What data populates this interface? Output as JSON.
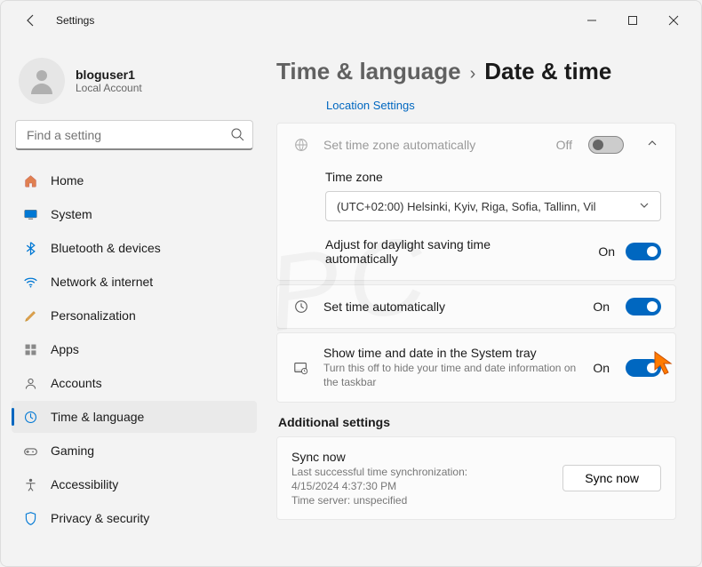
{
  "window": {
    "title": "Settings"
  },
  "user": {
    "name": "bloguser1",
    "subtitle": "Local Account"
  },
  "search": {
    "placeholder": "Find a setting"
  },
  "nav": {
    "home": "Home",
    "system": "System",
    "bluetooth": "Bluetooth & devices",
    "network": "Network & internet",
    "personalization": "Personalization",
    "apps": "Apps",
    "accounts": "Accounts",
    "time": "Time & language",
    "gaming": "Gaming",
    "accessibility": "Accessibility",
    "privacy": "Privacy & security"
  },
  "breadcrumb": {
    "parent": "Time & language",
    "sep": "›",
    "current": "Date & time"
  },
  "location_link": "Location Settings",
  "tz_auto": {
    "label": "Set time zone automatically",
    "state": "Off"
  },
  "tz": {
    "label": "Time zone",
    "value": "(UTC+02:00) Helsinki, Kyiv, Riga, Sofia, Tallinn, Vil"
  },
  "dst": {
    "label": "Adjust for daylight saving time automatically",
    "state": "On"
  },
  "time_auto": {
    "label": "Set time automatically",
    "state": "On"
  },
  "tray": {
    "label": "Show time and date in the System tray",
    "sub": "Turn this off to hide your time and date information on the taskbar",
    "state": "On"
  },
  "additional": "Additional settings",
  "sync": {
    "title": "Sync now",
    "line1": "Last successful time synchronization:",
    "line2": "4/15/2024 4:37:30 PM",
    "line3": "Time server: unspecified",
    "button": "Sync now"
  }
}
